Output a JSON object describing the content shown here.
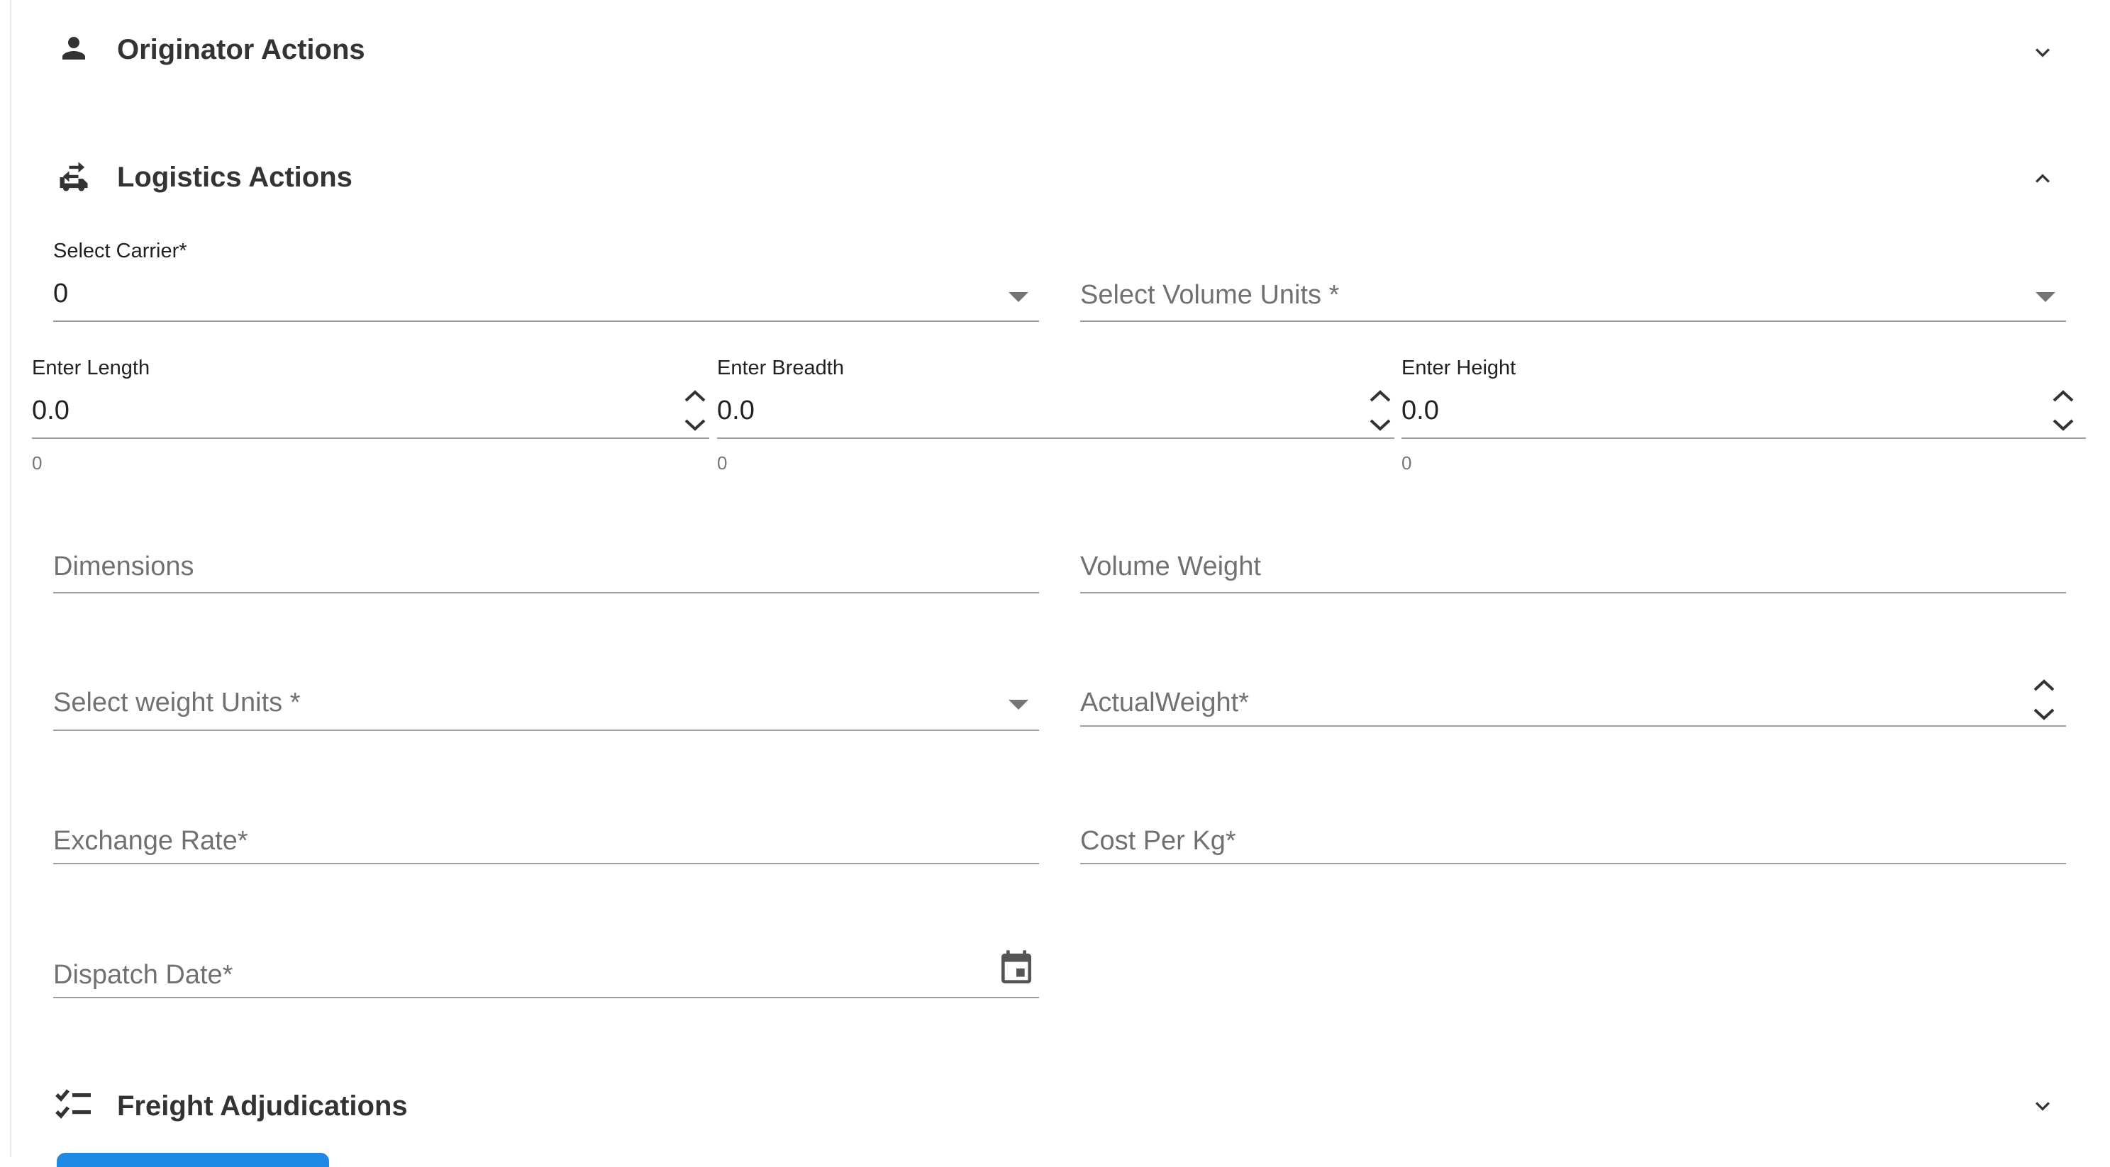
{
  "sections": {
    "originator": {
      "title": "Originator Actions",
      "icon": "person-icon",
      "state": "collapsed"
    },
    "logistics": {
      "title": "Logistics Actions",
      "icon": "local-shipping-swap-icon",
      "state": "expanded"
    },
    "freight": {
      "title": "Freight Adjudications",
      "icon": "checklist-icon",
      "state": "collapsed"
    }
  },
  "form": {
    "carrier": {
      "label": "Select Carrier*",
      "value": "0"
    },
    "volume_units": {
      "placeholder": "Select Volume Units *"
    },
    "length": {
      "label": "Enter Length",
      "value": "0.0",
      "helper": "0"
    },
    "breadth": {
      "label": "Enter Breadth",
      "value": "0.0",
      "helper": "0"
    },
    "height": {
      "label": "Enter Height",
      "value": "0.0",
      "helper": "0"
    },
    "dimensions": {
      "placeholder": "Dimensions"
    },
    "volume_weight": {
      "placeholder": "Volume Weight"
    },
    "weight_units": {
      "placeholder": "Select weight Units *"
    },
    "actual_weight": {
      "placeholder": "ActualWeight*"
    },
    "exchange_rate": {
      "placeholder": "Exchange Rate*"
    },
    "cost_per_kg": {
      "placeholder": "Cost Per Kg*"
    },
    "dispatch_date": {
      "placeholder": "Dispatch Date*",
      "icon": "calendar-icon"
    }
  },
  "colors": {
    "accent": "#1e88e5",
    "text": "#333333",
    "underline": "#9e9e9e"
  }
}
